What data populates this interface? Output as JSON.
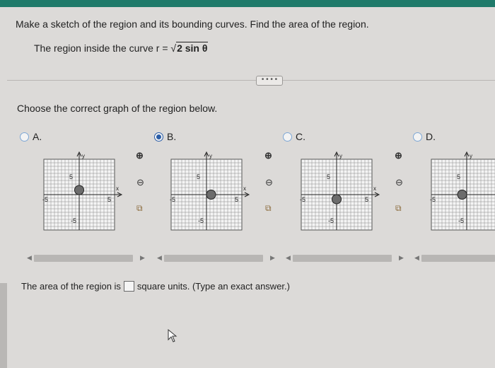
{
  "question": {
    "text": "Make a sketch of the region and its bounding curves. Find the area of the region.",
    "region_prefix": "The region inside the curve r =",
    "region_radicand": "2 sin θ"
  },
  "more_button_label": "• • • •",
  "choose_prompt": "Choose the correct graph of the region below.",
  "options": [
    {
      "label": "A.",
      "selected": false
    },
    {
      "label": "B.",
      "selected": true
    },
    {
      "label": "C.",
      "selected": false
    },
    {
      "label": "D.",
      "selected": false
    }
  ],
  "graph_labels": {
    "y": "y",
    "x": "x",
    "pos": "5",
    "neg": "-5"
  },
  "answer": {
    "prefix": "The area of the region is",
    "suffix": "square units. (Type an exact answer.)"
  },
  "colors": {
    "accent": "#1f7a6a",
    "radio": "#2a5da8",
    "region_fill": "#6c6c6c"
  }
}
